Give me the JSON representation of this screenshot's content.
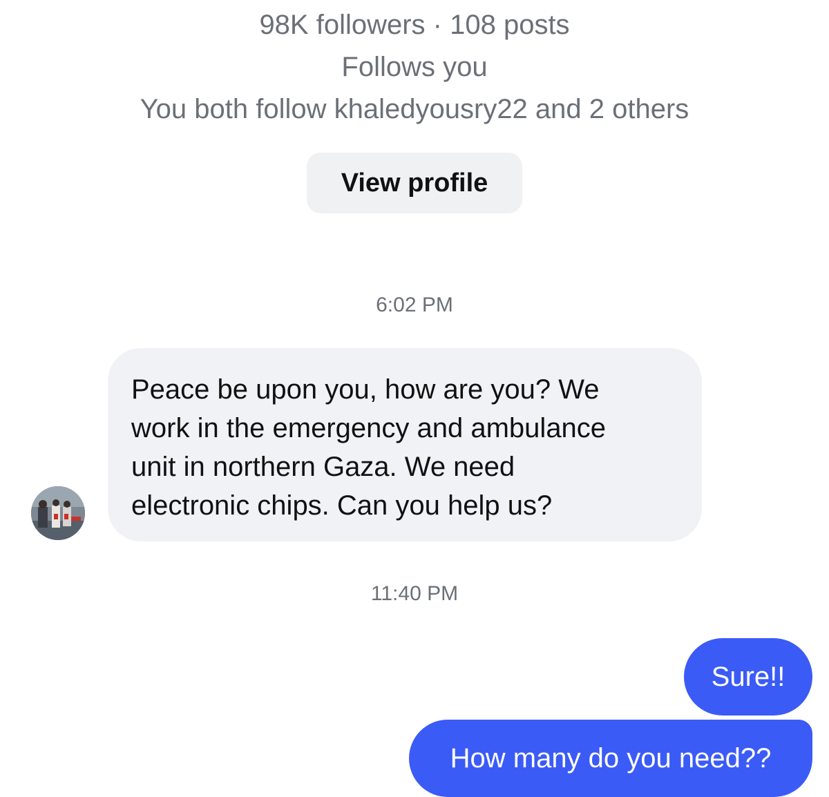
{
  "profile": {
    "stats": "98K followers · 108 posts",
    "follows_status": "Follows you",
    "mutual": "You both follow khaledyousry22 and 2 others",
    "view_profile_label": "View profile"
  },
  "messages": [
    {
      "timestamp": "6:02 PM",
      "direction": "incoming",
      "lines": [
        "Peace be upon you, how are you? We",
        "work in the emergency and ambulance",
        "unit in northern Gaza. We need",
        "electronic chips. Can you help us?"
      ]
    },
    {
      "timestamp": "11:40 PM",
      "direction": "outgoing",
      "text": "Sure!!"
    },
    {
      "direction": "outgoing",
      "text": "How many do you need??"
    }
  ],
  "colors": {
    "outgoing_bubble": "#3b5bf6",
    "incoming_bubble": "#f1f2f5",
    "secondary_text": "#6b6f76"
  }
}
